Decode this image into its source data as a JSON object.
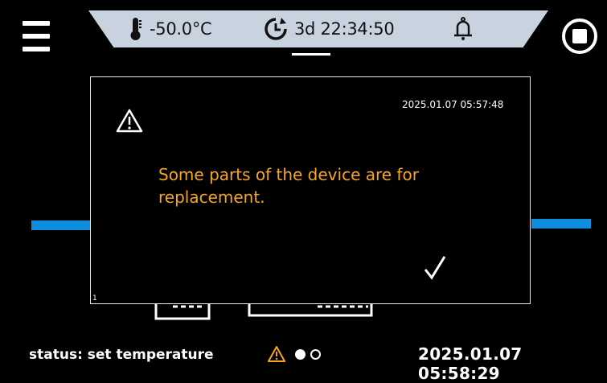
{
  "topbar": {
    "temperature": "-50.0°C",
    "timer": "3d 22:34:50",
    "icons": {
      "temperature": "thermometer-icon",
      "timer": "timer-icon",
      "alarm": "bell-icon",
      "menu": "hamburger-menu-icon",
      "stop": "stop-icon"
    }
  },
  "dialog": {
    "timestamp": "2025.01.07 05:57:48",
    "message": "Some parts of the device are for replacement.",
    "index": "1",
    "message_color": "#f5a623",
    "icons": {
      "warning": "warning-icon",
      "confirm": "checkmark-icon"
    }
  },
  "statusbar": {
    "status": "status: set temperature",
    "datetime": "2025.01.07 05:58:29",
    "page_indicator": {
      "pages": 2,
      "current": 1
    },
    "icons": {
      "alert": "warning-icon"
    }
  },
  "colors": {
    "accent_blue": "#0f8ede",
    "topbar_bg": "#c9d3df",
    "warning_orange": "#f5a623"
  }
}
